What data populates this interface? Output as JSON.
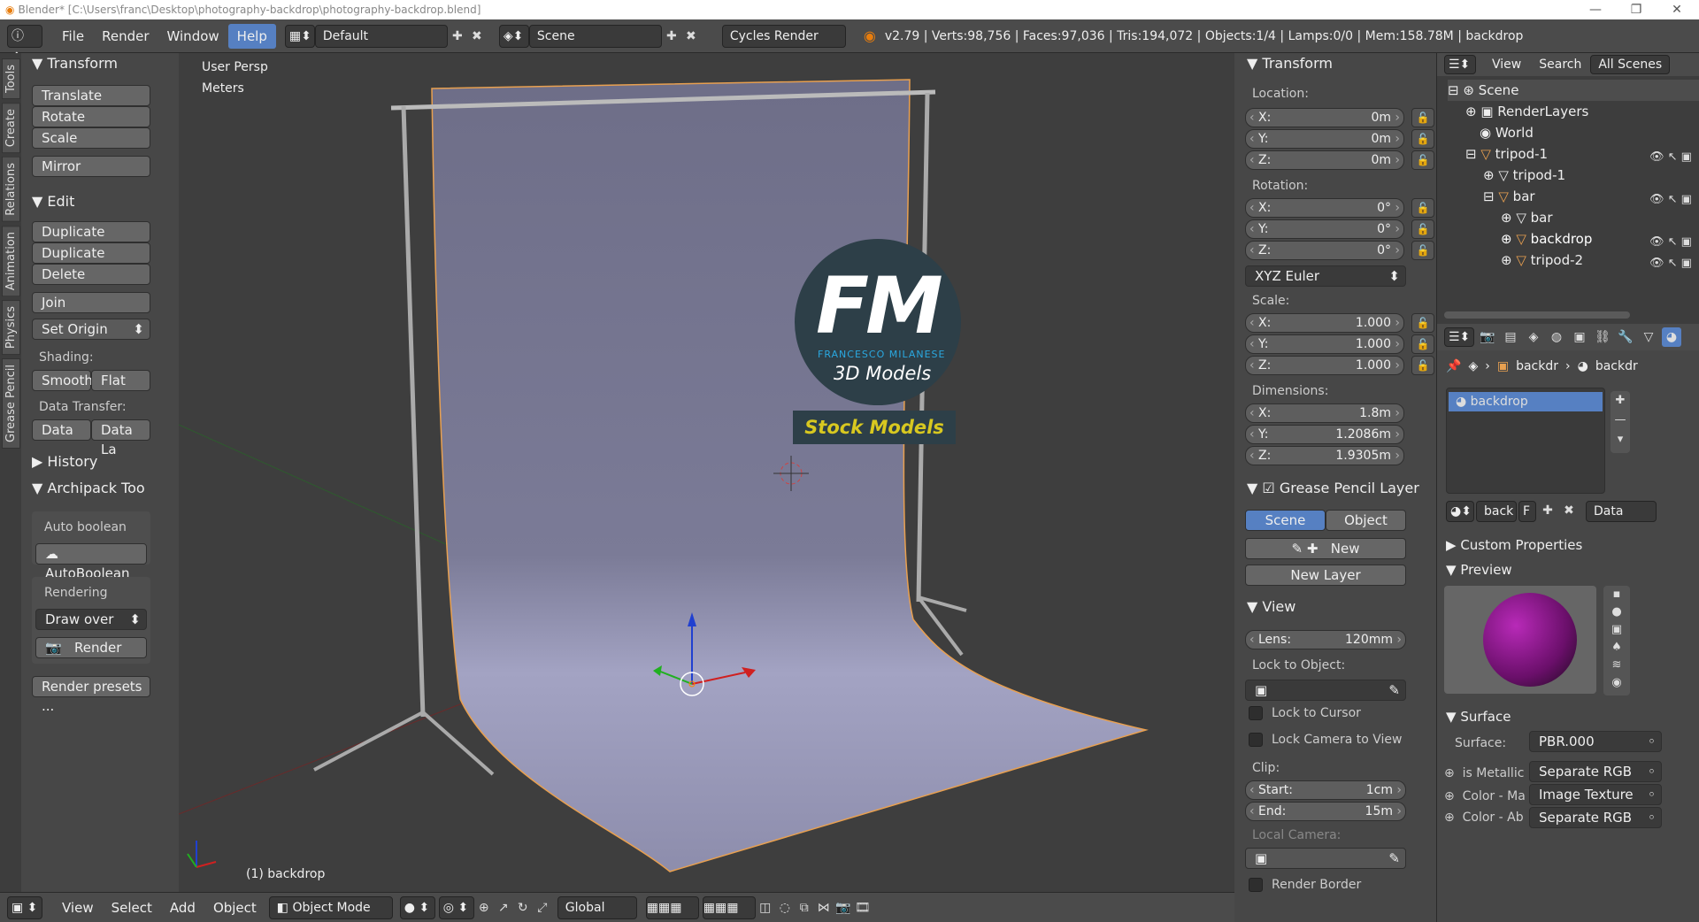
{
  "window": {
    "title": "Blender* [C:\\Users\\franc\\Desktop\\photography-backdrop\\photography-backdrop.blend]"
  },
  "topbar": {
    "menus": [
      "File",
      "Render",
      "Window",
      "Help"
    ],
    "layout": "Default",
    "scene": "Scene",
    "engine": "Cycles Render",
    "stats": "v2.79 | Verts:98,756 | Faces:97,036 | Tris:194,072 | Objects:1/4 | Lamps:0/0 | Mem:158.78M | backdrop"
  },
  "sidetabs": [
    "Tools",
    "Create",
    "Relations",
    "Animation",
    "Physics",
    "Grease Pencil"
  ],
  "tools": {
    "transform_header": "Transform",
    "translate": "Translate",
    "rotate": "Rotate",
    "scale": "Scale",
    "mirror": "Mirror",
    "edit_header": "Edit",
    "duplicate": "Duplicate",
    "duplicate_linked": "Duplicate Linked",
    "delete": "Delete",
    "join": "Join",
    "set_origin": "Set Origin",
    "shading_label": "Shading:",
    "smooth": "Smooth",
    "flat": "Flat",
    "data_transfer_label": "Data Transfer:",
    "data": "Data",
    "data_la": "Data La",
    "history_header": "History",
    "archipack_header": "Archipack Too",
    "auto_boolean_label": "Auto boolean",
    "autoboolean": "AutoBoolean",
    "rendering_label": "Rendering",
    "draw_over": "Draw over",
    "render": "Render",
    "render_presets": "Render presets ..."
  },
  "viewport": {
    "persp": "User Persp",
    "units": "Meters",
    "object_label": "(1) backdrop",
    "logo_fm": "FM",
    "logo_name": "FRANCESCO MILANESE",
    "logo_sub": "3D Models",
    "logo_banner": "Stock Models"
  },
  "bottombar": {
    "view": "View",
    "select": "Select",
    "add": "Add",
    "object": "Object",
    "mode": "Object Mode",
    "orientation": "Global"
  },
  "nprops": {
    "transform_header": "Transform",
    "location_label": "Location:",
    "loc_x": "0m",
    "loc_y": "0m",
    "loc_z": "0m",
    "rotation_label": "Rotation:",
    "rot_x": "0°",
    "rot_y": "0°",
    "rot_z": "0°",
    "rotation_mode": "XYZ Euler",
    "scale_label": "Scale:",
    "scale_x": "1.000",
    "scale_y": "1.000",
    "scale_z": "1.000",
    "dimensions_label": "Dimensions:",
    "dim_x": "1.8m",
    "dim_y": "1.2086m",
    "dim_z": "1.9305m",
    "gp_header": "Grease Pencil Layer",
    "gp_scene": "Scene",
    "gp_object": "Object",
    "gp_new": "New",
    "gp_new_layer": "New Layer",
    "view_header": "View",
    "lens_label": "Lens:",
    "lens_value": "120mm",
    "lock_to_object_label": "Lock to Object:",
    "lock_cursor": "Lock to Cursor",
    "lock_camera": "Lock Camera to View",
    "clip_label": "Clip:",
    "clip_start_label": "Start:",
    "clip_start": "1cm",
    "clip_end_label": "End:",
    "clip_end": "15m",
    "local_camera_label": "Local Camera:",
    "render_border": "Render Border",
    "x": "X:",
    "y": "Y:",
    "z": "Z:"
  },
  "outliner": {
    "view": "View",
    "search": "Search",
    "filter": "All Scenes",
    "rows": [
      "Scene",
      "RenderLayers",
      "World",
      "tripod-1",
      "tripod-1",
      "bar",
      "bar",
      "backdrop",
      "tripod-2"
    ]
  },
  "props": {
    "breadcrumb1": "backdr",
    "breadcrumb2": "backdr",
    "slot": "backdrop",
    "mat_name": "back",
    "mat_f": "F",
    "link": "Data",
    "custom_props": "Custom Properties",
    "preview": "Preview",
    "surface_header": "Surface",
    "surface_label": "Surface:",
    "surface_value": "PBR.000",
    "is_metallic_label": "is Metallic",
    "is_metallic_value": "Separate RGB",
    "color_ma_label": "Color - Ma",
    "color_ma_value": "Image Texture",
    "color_ab_label": "Color - Ab",
    "color_ab_value": "Separate RGB"
  }
}
